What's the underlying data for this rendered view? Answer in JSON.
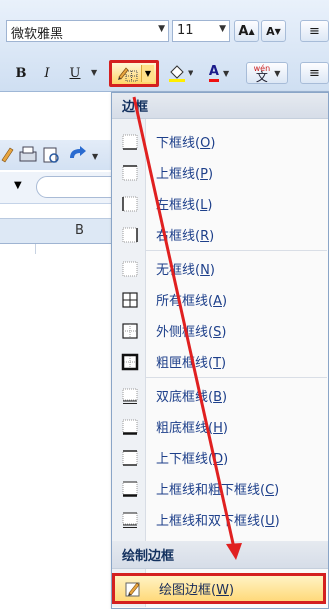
{
  "ribbon": {
    "font_name": "微软雅黑",
    "font_size": "11",
    "grow_font_label": "A",
    "shrink_font_label": "A",
    "bold_label": "B",
    "italic_label": "I",
    "underline_label": "U",
    "font_color_label": "A",
    "phonetic_label": "wén",
    "phonetic_char": "文",
    "accent_color": "#d42020"
  },
  "sheet": {
    "column_b": "B"
  },
  "menu": {
    "section_borders": "边框",
    "section_draw": "绘制边框",
    "items": [
      {
        "name": "下框线",
        "key": "O",
        "icon": "bottom-border-icon"
      },
      {
        "name": "上框线",
        "key": "P",
        "icon": "top-border-icon"
      },
      {
        "name": "左框线",
        "key": "L",
        "icon": "left-border-icon"
      },
      {
        "name": "右框线",
        "key": "R",
        "icon": "right-border-icon"
      },
      {
        "name": "无框线",
        "key": "N",
        "icon": "no-border-icon"
      },
      {
        "name": "所有框线",
        "key": "A",
        "icon": "all-borders-icon"
      },
      {
        "name": "外侧框线",
        "key": "S",
        "icon": "outside-borders-icon"
      },
      {
        "name": "粗匣框线",
        "key": "T",
        "icon": "thick-box-border-icon"
      },
      {
        "name": "双底框线",
        "key": "B",
        "icon": "double-bottom-border-icon"
      },
      {
        "name": "粗底框线",
        "key": "H",
        "icon": "thick-bottom-border-icon"
      },
      {
        "name": "上下框线",
        "key": "D",
        "icon": "top-bottom-border-icon"
      },
      {
        "name": "上框线和粗下框线",
        "key": "C",
        "icon": "top-thick-bottom-border-icon"
      },
      {
        "name": "上框线和双下框线",
        "key": "U",
        "icon": "top-double-bottom-border-icon"
      }
    ],
    "draw_border": {
      "name": "绘图边框",
      "key": "W",
      "icon": "draw-border-pencil-icon"
    }
  }
}
